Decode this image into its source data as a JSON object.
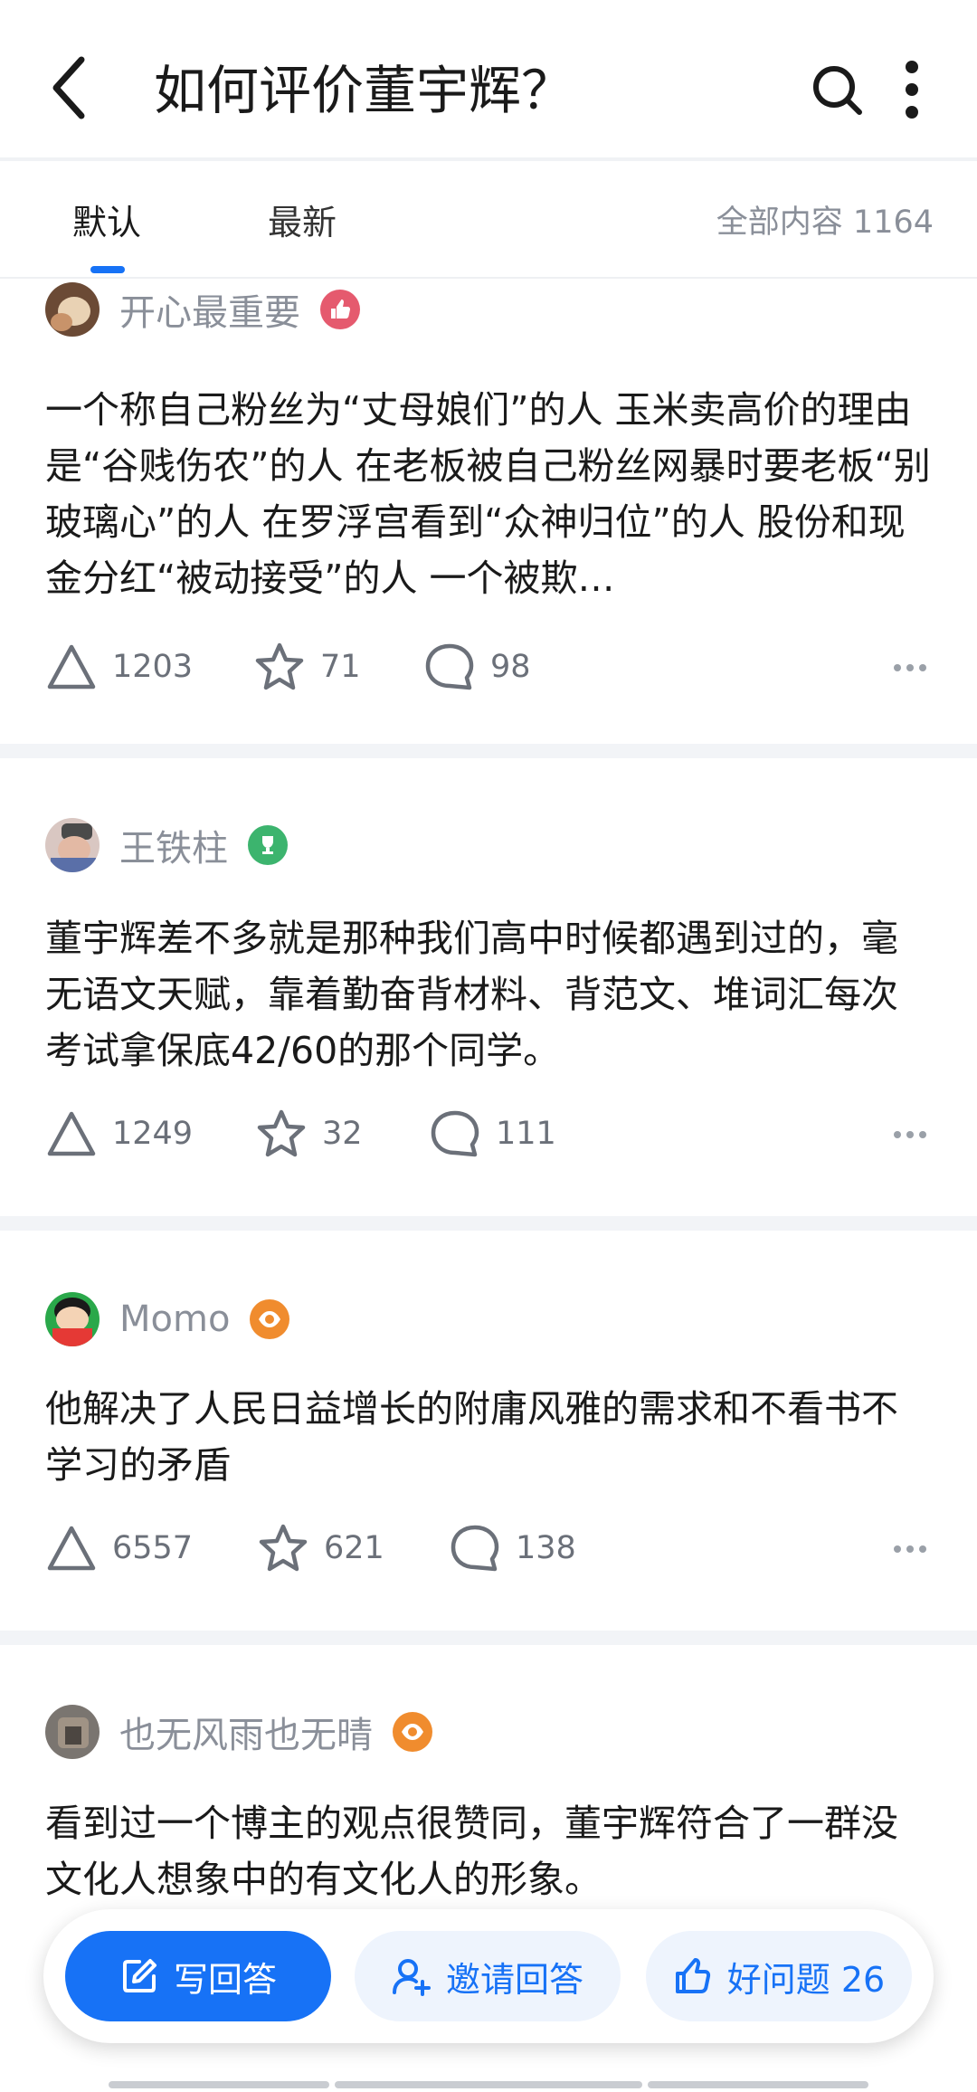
{
  "header": {
    "title": "如何评价董宇辉？",
    "back_icon": "chevron-left-icon",
    "search_icon": "search-icon",
    "more_icon": "more-vertical-icon"
  },
  "tabs": {
    "items": [
      {
        "label": "默认",
        "active": true
      },
      {
        "label": "最新",
        "active": false
      }
    ],
    "total": "全部内容 1164",
    "accent_color": "#1772f6"
  },
  "answers": [
    {
      "author": "开心最重要",
      "badge": "thumbs-up-badge-icon",
      "text": "一个称自己粉丝为“丈母娘们”的人 玉米卖高价的理由是“谷贱伤农”的人 在老板被自己粉丝网暴时要老板“别玻璃心”的人 在罗浮宫看到“众神归位”的人 股份和现金分红“被动接受”的人 一个被欺…",
      "upvotes": "1203",
      "favorites": "71",
      "comments": "98"
    },
    {
      "author": "王铁柱",
      "badge": "trophy-badge-icon",
      "text": "董宇辉差不多就是那种我们高中时候都遇到过的，毫无语文天赋，靠着勤奋背材料、背范文、堆词汇每次考试拿保底42/60的那个同学。",
      "upvotes": "1249",
      "favorites": "32",
      "comments": "111"
    },
    {
      "author": "Momo",
      "badge": "eye-badge-icon",
      "text": "他解决了人民日益增长的附庸风雅的需求和不看书不学习的矛盾",
      "upvotes": "6557",
      "favorites": "621",
      "comments": "138"
    },
    {
      "author": "也无风雨也无晴",
      "badge": "eye-badge-icon",
      "text": "看到过一个博主的观点很赞同，董宇辉符合了一群没文化人想象中的有文化人的形象。",
      "upvotes": "",
      "favorites": "",
      "comments": ""
    }
  ],
  "bottom_bar": {
    "write_answer": "写回答",
    "invite_answer": "邀请回答",
    "good_question": "好问题 26",
    "write_icon": "edit-icon",
    "invite_icon": "add-user-icon",
    "good_icon": "thumbs-up-icon"
  }
}
